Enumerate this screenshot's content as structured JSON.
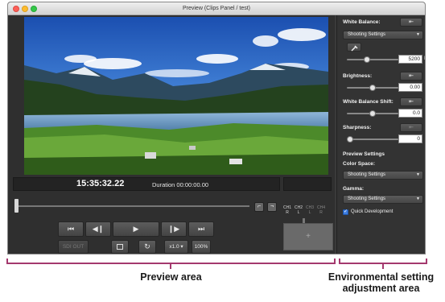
{
  "window": {
    "title": "Preview (Clips Panel / test)"
  },
  "preview": {
    "timecode": "15:35:32.22",
    "duration": "Duration 00:00:00.00",
    "channels": [
      {
        "top": "CH1",
        "bottom": "R"
      },
      {
        "top": "CH2",
        "bottom": "L"
      },
      {
        "top": "CH3",
        "bottom": "L"
      },
      {
        "top": "CH4",
        "bottom": "R"
      }
    ],
    "buttons": {
      "goto_start": "⏮",
      "step_back": "◀❙",
      "play": "▶",
      "step_forward": "❙▶",
      "goto_end": "⏭",
      "sdi_out": "SDI OUT",
      "speed": "x1.0",
      "zoom": "100%"
    },
    "seek_position": 0
  },
  "settings": {
    "white_balance": {
      "label": "White Balance:",
      "dropdown": "Shooting Settings",
      "value": "5200",
      "unit": "K",
      "slider": 0.38
    },
    "brightness": {
      "label": "Brightness:",
      "value": "0.00",
      "slider": 0.5
    },
    "wb_shift": {
      "label": "White Balance Shift:",
      "value": "0.0",
      "slider": 0.5
    },
    "sharpness": {
      "label": "Sharpness:",
      "value": "0",
      "slider": 0.0
    },
    "preview_settings": {
      "label": "Preview Settings"
    },
    "color_space": {
      "label": "Color Space:",
      "dropdown": "Shooting Settings"
    },
    "gamma": {
      "label": "Gamma:",
      "dropdown": "Shooting Settings"
    },
    "quick_development": {
      "label": "Quick Development",
      "checked": true
    }
  },
  "captions": {
    "preview_area": "Preview area",
    "environmental_line1": "Environmental setting",
    "environmental_line2": "adjustment area"
  },
  "colors": {
    "bracket": "#a4396e",
    "accent": "#3d7de0"
  }
}
